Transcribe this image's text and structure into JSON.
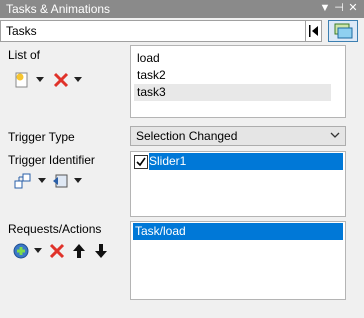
{
  "titlebar": {
    "title": "Tasks & Animations",
    "pin_icon": "pin-icon",
    "close_icon": "close-icon"
  },
  "panel_selector": {
    "value": "Tasks"
  },
  "list_of": {
    "label": "List of",
    "items": [
      "load",
      "task2",
      "task3"
    ],
    "selected_index": 2
  },
  "trigger_type": {
    "label": "Trigger Type",
    "value": "Selection Changed"
  },
  "trigger_identifier": {
    "label": "Trigger Identifier",
    "items": [
      {
        "label": "Slider1",
        "checked": true
      }
    ]
  },
  "requests_actions": {
    "label": "Requests/Actions",
    "items": [
      "Task/load"
    ]
  },
  "colors": {
    "titlebar": "#8a8a8a",
    "selection": "#0078d7",
    "background": "#f0f0f0"
  }
}
